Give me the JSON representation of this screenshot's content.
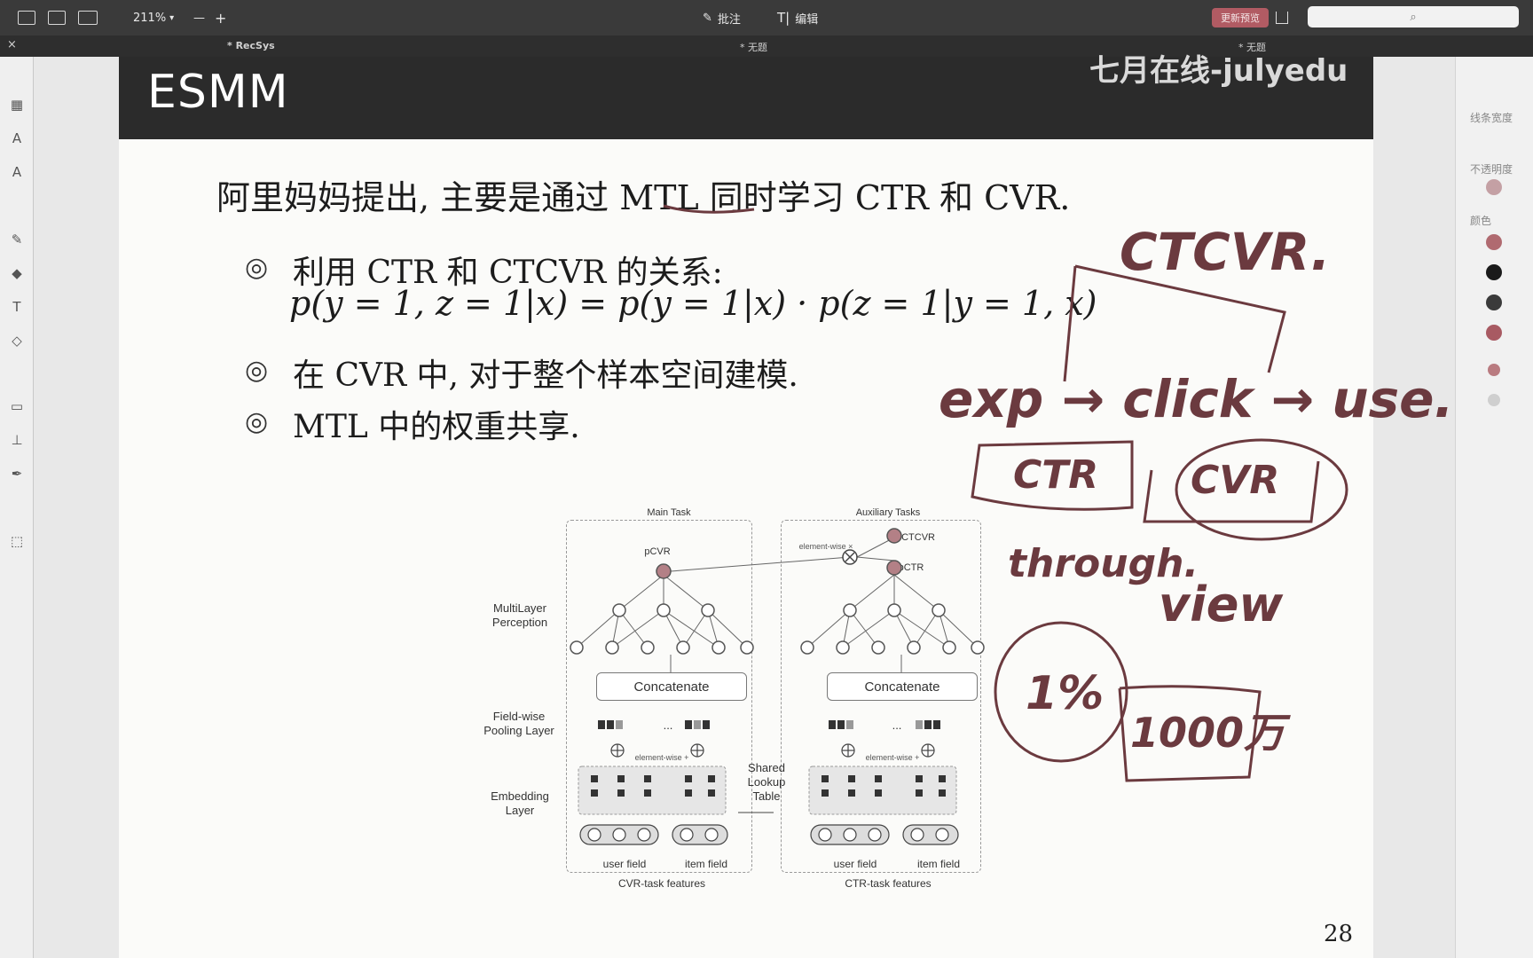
{
  "toolbar": {
    "zoom": "211%",
    "zoom_out": "—",
    "zoom_in": "+",
    "annotate": "批注",
    "edit_icon_text": "T|",
    "edit": "编辑",
    "accent_button": "更新预览",
    "search_icon": "⌕"
  },
  "tabs": {
    "close": "×",
    "tab1": "* RecSys",
    "tab2": "* 无题",
    "tab3": "* 无题"
  },
  "rightpanel": {
    "line_width": "线条宽度",
    "opacity": "不透明度",
    "color": "颜色",
    "swatches": [
      "#b06a70",
      "#1a1a1a",
      "#3a3a3a",
      "#a85a62",
      "#b97b80",
      "#cfcfcf"
    ]
  },
  "slide": {
    "title": "ESMM",
    "watermark": "七月在线-julyedu",
    "main_line": "阿里妈妈提出, 主要是通过 MTL 同时学习 CTR 和 CVR.",
    "bullets": [
      "利用 CTR 和 CTCVR 的关系:",
      "在 CVR 中, 对于整个样本空间建模.",
      "MTL 中的权重共享."
    ],
    "bullet_mark": "◎",
    "formula": "p(y = 1, z = 1|x) = p(y = 1|x) · p(z = 1|y = 1, x)",
    "page_number": "28"
  },
  "diagram": {
    "main_task": "Main Task",
    "aux_tasks": "Auxiliary Tasks",
    "pcvr": "pCVR",
    "pctcvr": "pCTCVR",
    "pctr": "pCTR",
    "element_wise_x": "element-wise ×",
    "mlp": "MultiLayer\nPerception",
    "concatenate": "Concatenate",
    "field_wise": "Field-wise\nPooling Layer",
    "element_wise_plus": "element-wise +",
    "embedding": "Embedding\nLayer",
    "shared_lookup": "Shared\nLookup\nTable",
    "user_field": "user field",
    "item_field": "item field",
    "cvr_features": "CVR-task features",
    "ctr_features": "CTR-task features",
    "dots": "..."
  },
  "handwriting": {
    "ctcvr": "CTCVR.",
    "flow": "exp → click → use.",
    "ctr": "CTR",
    "cvr": "CVR",
    "through": "through.",
    "view": "view",
    "percent": "1%",
    "ten_million": "1000万"
  }
}
